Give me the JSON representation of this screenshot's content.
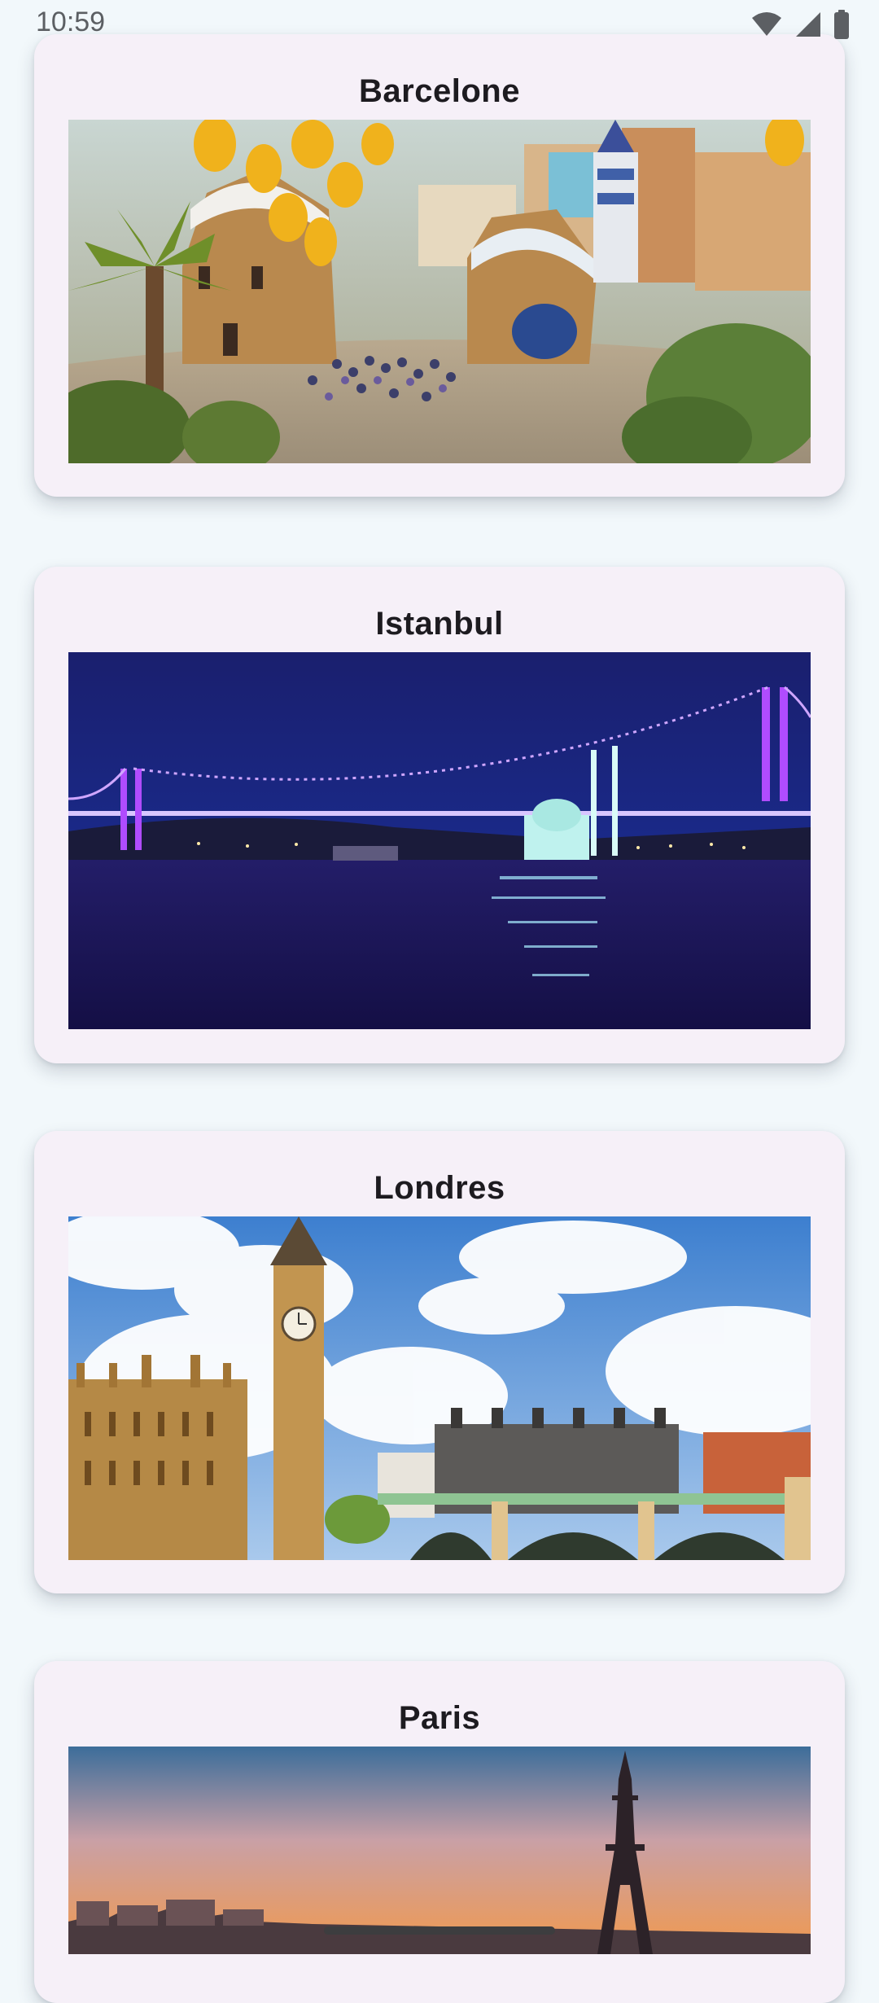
{
  "status_bar": {
    "time": "10:59",
    "icons": [
      "wifi-icon",
      "cellular-signal-icon",
      "battery-icon"
    ]
  },
  "destinations": [
    {
      "title": "Barcelone",
      "image": "barcelona-park-guell-photo"
    },
    {
      "title": "Istanbul",
      "image": "istanbul-bosphorus-bridge-night-photo"
    },
    {
      "title": "Londres",
      "image": "london-big-ben-westminster-photo"
    },
    {
      "title": "Paris",
      "image": "paris-eiffel-tower-sunset-photo"
    }
  ],
  "colors": {
    "background": "#f2f8fb",
    "card": "#f6f0f8",
    "title_text": "#1d1b20"
  }
}
